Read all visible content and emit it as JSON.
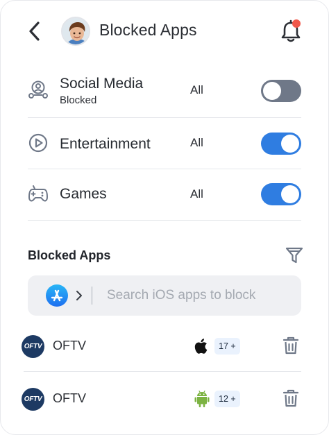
{
  "header": {
    "title": "Blocked Apps",
    "notification_dot_color": "#f0584a",
    "icons": {
      "back": "chevron-left-icon",
      "bell": "bell-icon"
    }
  },
  "categories": [
    {
      "name": "Social Media",
      "status": "Blocked",
      "scope": "All",
      "enabled": false,
      "icon": "social-people-icon"
    },
    {
      "name": "Entertainment",
      "status": "",
      "scope": "All",
      "enabled": true,
      "icon": "play-circle-icon"
    },
    {
      "name": "Games",
      "status": "",
      "scope": "All",
      "enabled": true,
      "icon": "gamepad-icon"
    }
  ],
  "blocked_section": {
    "title": "Blocked Apps",
    "filter_icon": "filter-icon",
    "search": {
      "placeholder": "Search iOS apps to block",
      "value": "",
      "store_icon": "app-store-icon"
    },
    "apps": [
      {
        "logo_text": "OFTV",
        "name": "OFTV",
        "platform": "apple-icon",
        "age_rating": "17 +"
      },
      {
        "logo_text": "OFTV",
        "name": "OFTV",
        "platform": "android-icon",
        "age_rating": "12 +"
      }
    ]
  },
  "colors": {
    "accent": "#2f7de1",
    "toggle_off": "#6f7888",
    "android_green": "#7cb342",
    "oftv_logo_bg": "#1d3a63"
  }
}
